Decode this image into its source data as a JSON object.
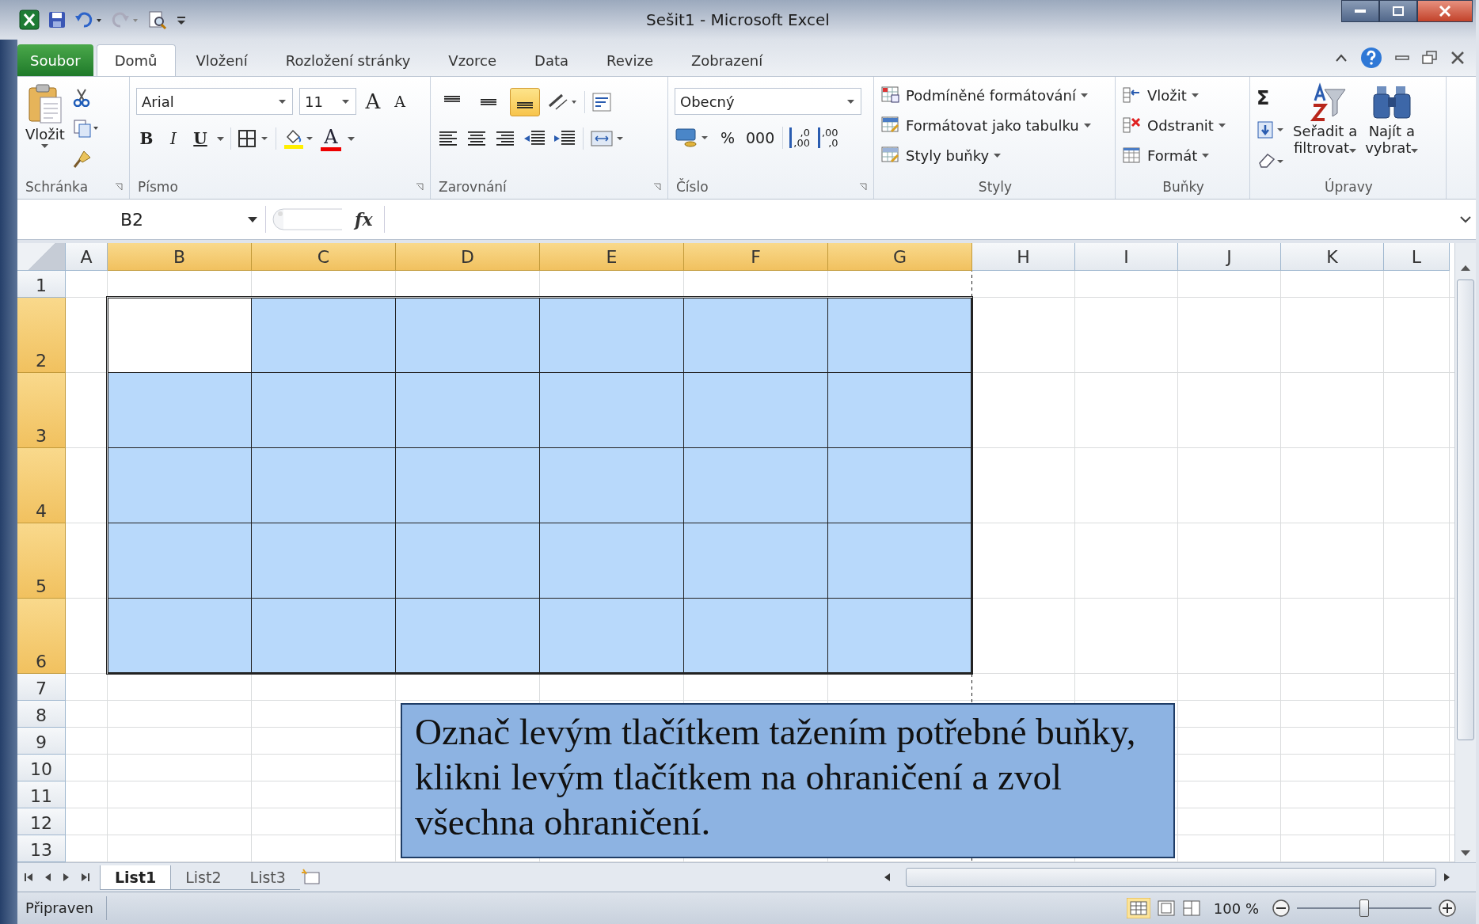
{
  "window": {
    "title": "Sešit1  -  Microsoft Excel"
  },
  "file_tab": "Soubor",
  "tabs": [
    {
      "label": "Domů",
      "selected": true
    },
    {
      "label": "Vložení",
      "selected": false
    },
    {
      "label": "Rozložení stránky",
      "selected": false
    },
    {
      "label": "Vzorce",
      "selected": false
    },
    {
      "label": "Data",
      "selected": false
    },
    {
      "label": "Revize",
      "selected": false
    },
    {
      "label": "Zobrazení",
      "selected": false
    }
  ],
  "ribbon": {
    "clipboard": {
      "label": "Schránka",
      "paste": "Vložit"
    },
    "font": {
      "label": "Písmo",
      "family": "Arial",
      "size": "11",
      "grow": "A",
      "shrink": "A",
      "bold": "B",
      "italic": "I",
      "underline": "U",
      "font_color": "A"
    },
    "alignment": {
      "label": "Zarovnání",
      "vertical": [
        {
          "selected": false
        },
        {
          "selected": false
        },
        {
          "selected": true
        }
      ]
    },
    "number": {
      "label": "Číslo",
      "format": "Obecný",
      "percent": "%",
      "thousands": "000",
      "decimals": [
        {
          "top": ",0",
          "bottom": ",00"
        },
        {
          "top": ",00",
          "bottom": ",0"
        }
      ]
    },
    "styles": {
      "label": "Styly",
      "items": [
        "Podmíněné formátování",
        "Formátovat jako tabulku",
        "Styly buňky"
      ]
    },
    "cells": {
      "label": "Buňky",
      "items": [
        "Vložit",
        "Odstranit",
        "Formát"
      ]
    },
    "editing": {
      "label": "Úpravy",
      "sum": "Σ",
      "sort": [
        "Seřadit a",
        "filtrovat"
      ],
      "find": [
        "Najít a",
        "vybrat"
      ]
    }
  },
  "formula_bar": {
    "name_box": "B2",
    "fx": "fx"
  },
  "sheet": {
    "columns": [
      {
        "label": "A",
        "selected": false
      },
      {
        "label": "B",
        "selected": true
      },
      {
        "label": "C",
        "selected": true
      },
      {
        "label": "D",
        "selected": true
      },
      {
        "label": "E",
        "selected": true
      },
      {
        "label": "F",
        "selected": true
      },
      {
        "label": "G",
        "selected": true
      },
      {
        "label": "H",
        "selected": false
      },
      {
        "label": "I",
        "selected": false
      },
      {
        "label": "J",
        "selected": false
      },
      {
        "label": "K",
        "selected": false
      },
      {
        "label": "L",
        "selected": false
      }
    ],
    "rows": [
      {
        "label": "1",
        "selected": false
      },
      {
        "label": "2",
        "selected": true
      },
      {
        "label": "3",
        "selected": true
      },
      {
        "label": "4",
        "selected": true
      },
      {
        "label": "5",
        "selected": true
      },
      {
        "label": "6",
        "selected": true
      },
      {
        "label": "7",
        "selected": false
      },
      {
        "label": "8",
        "selected": false
      },
      {
        "label": "9",
        "selected": false
      },
      {
        "label": "10",
        "selected": false
      },
      {
        "label": "11",
        "selected": false
      },
      {
        "label": "12",
        "selected": false
      },
      {
        "label": "13",
        "selected": false
      }
    ]
  },
  "callout": {
    "text": "Označ levým tlačítkem tažením potřebné buňky, klikni levým tlačítkem na ohraničení a zvol všechna ohraničení."
  },
  "sheet_tabs": [
    {
      "label": "List1",
      "selected": true
    },
    {
      "label": "List2",
      "selected": false
    },
    {
      "label": "List3",
      "selected": false
    }
  ],
  "status_bar": {
    "text": "Připraven",
    "zoom": "100 %",
    "level": 0.5
  }
}
